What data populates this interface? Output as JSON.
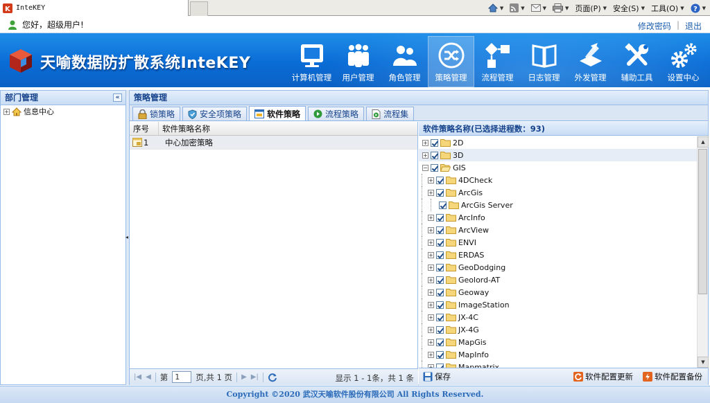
{
  "browser": {
    "tab_title": "InteKEY",
    "menu": {
      "page": "页面(P)",
      "safety": "安全(S)",
      "tools": "工具(O)"
    }
  },
  "greeting": {
    "text": "您好，超级用户!",
    "change_password": "修改密码",
    "sep": "|",
    "logout": "退出"
  },
  "header": {
    "brand": "天喻数据防扩散系统InteKEY",
    "nav": [
      {
        "label": "计算机管理",
        "icon": "computer-icon"
      },
      {
        "label": "用户管理",
        "icon": "users-icon"
      },
      {
        "label": "角色管理",
        "icon": "roles-icon"
      },
      {
        "label": "策略管理",
        "icon": "shuffle-icon",
        "active": true
      },
      {
        "label": "流程管理",
        "icon": "flowchart-icon"
      },
      {
        "label": "日志管理",
        "icon": "book-icon"
      },
      {
        "label": "外发管理",
        "icon": "send-icon"
      },
      {
        "label": "辅助工具",
        "icon": "tools-icon"
      },
      {
        "label": "设置中心",
        "icon": "gears-icon"
      }
    ]
  },
  "left_panel": {
    "title": "部门管理",
    "collapse": "«",
    "tree": [
      {
        "label": "信息中心"
      }
    ]
  },
  "main": {
    "title": "策略管理",
    "tabs": [
      {
        "label": "锁策略",
        "icon": "lock-icon"
      },
      {
        "label": "安全项策略",
        "icon": "shield-icon"
      },
      {
        "label": "软件策略",
        "icon": "software-icon",
        "active": true
      },
      {
        "label": "流程策略",
        "icon": "flow-icon"
      },
      {
        "label": "流程集",
        "icon": "flowset-icon"
      }
    ],
    "grid": {
      "columns": [
        "序号",
        "软件策略名称"
      ],
      "rows": [
        {
          "no": "1",
          "name": "中心加密策略"
        }
      ]
    },
    "pager": {
      "page_prefix": "第",
      "page_value": "1",
      "page_suffix": "页,共 1 页",
      "display": "显示 1 - 1条，共 1 条"
    },
    "tree_panel": {
      "title": "软件策略名称(已选择进程数：93)",
      "top_nodes": [
        {
          "label": "2D",
          "expanded": false
        },
        {
          "label": "3D",
          "expanded": false
        },
        {
          "label": "GIS",
          "expanded": true
        }
      ],
      "children": [
        {
          "label": "4DCheck",
          "expandable": true
        },
        {
          "label": "ArcGis",
          "expandable": true
        },
        {
          "label": "ArcGis Server",
          "expandable": false
        },
        {
          "label": "ArcInfo",
          "expandable": true
        },
        {
          "label": "ArcView",
          "expandable": true
        },
        {
          "label": "ENVI",
          "expandable": true
        },
        {
          "label": "ERDAS",
          "expandable": true
        },
        {
          "label": "GeoDodging",
          "expandable": true
        },
        {
          "label": "Geolord-AT",
          "expandable": true
        },
        {
          "label": "Geoway",
          "expandable": true
        },
        {
          "label": "ImageStation",
          "expandable": true
        },
        {
          "label": "JX-4C",
          "expandable": true
        },
        {
          "label": "JX-4G",
          "expandable": true
        },
        {
          "label": "MapGis",
          "expandable": true
        },
        {
          "label": "MapInfo",
          "expandable": true
        },
        {
          "label": "Mapmatrix",
          "expandable": true
        }
      ],
      "save": "保存",
      "update": "软件配置更新",
      "backup": "软件配置备份"
    }
  },
  "footer": {
    "copyright": "Copyright ©2020 武汉天喻软件股份有限公司 All Rights Reserved."
  },
  "colors": {
    "header_blue": "#0a6cd6",
    "panel_title": "#15428b",
    "border": "#99bbe8"
  }
}
